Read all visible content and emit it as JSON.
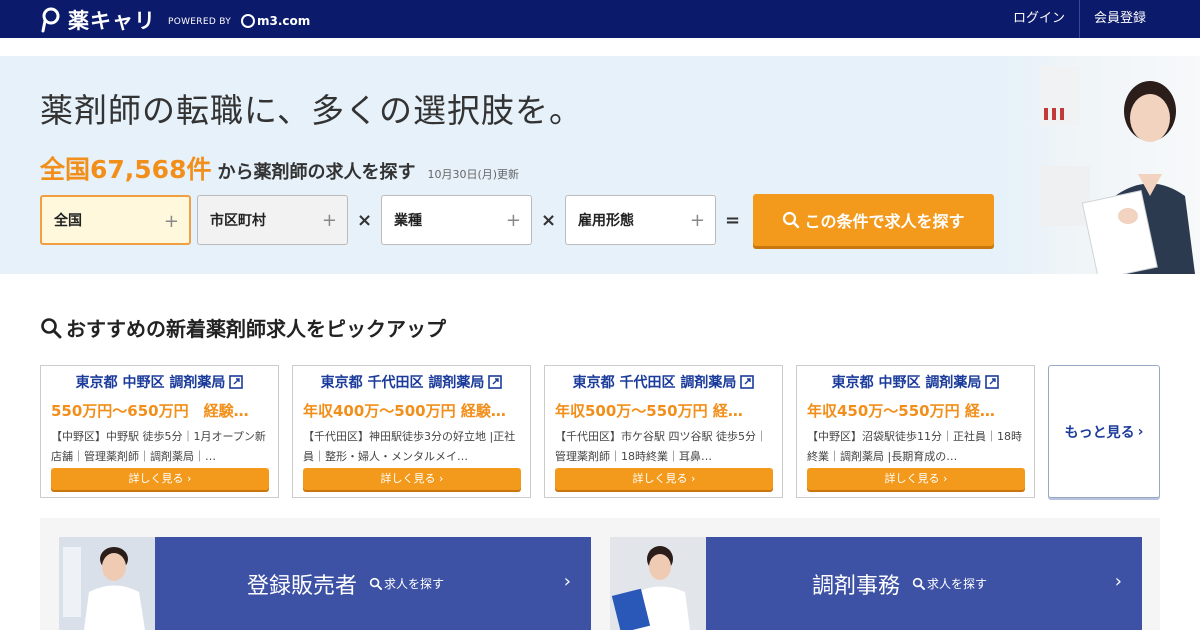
{
  "header": {
    "logo_text": "薬キャリ",
    "powered_by": "POWERED BY",
    "partner": "m3.com",
    "nav": [
      "ログイン",
      "会員登録"
    ]
  },
  "hero": {
    "title": "薬剤師の転職に、多くの選択肢を。",
    "count": "全国67,568件",
    "sub": "から薬剤師の求人を探す",
    "updated": "10月30日(月)更新",
    "filters": [
      "全国",
      "市区町村",
      "業種",
      "雇用形態"
    ],
    "op_times": "×",
    "op_equals": "=",
    "search_button": "この条件で求人を探す"
  },
  "section": {
    "title": "おすすめの新着薬剤師求人をピックアップ"
  },
  "cards": [
    {
      "title": "東京都 中野区 調剤薬局",
      "salary": "550万円〜650万円　経験…",
      "desc": "【中野区】中野駅 徒歩5分｜1月オープン新店舗｜管理薬剤師｜調剤薬局｜…",
      "button": "詳しく見る"
    },
    {
      "title": "東京都 千代田区 調剤薬局",
      "salary": "年収400万〜500万円 経験…",
      "desc": "【千代田区】神田駅徒歩3分の好立地 |正社員｜整形・婦人・メンタルメイ…",
      "button": "詳しく見る"
    },
    {
      "title": "東京都 千代田区 調剤薬局",
      "salary": "年収500万〜550万円 経…",
      "desc": "【千代田区】市ケ谷駅 四ツ谷駅 徒歩5分｜管理薬剤師｜18時終業｜耳鼻…",
      "button": "詳しく見る"
    },
    {
      "title": "東京都 中野区 調剤薬局",
      "salary": "年収450万〜550万円 経…",
      "desc": "【中野区】沼袋駅徒歩11分｜正社員｜18時終業｜調剤薬局 |長期育成の…",
      "button": "詳しく見る"
    }
  ],
  "more": "もっと見る",
  "panels": [
    {
      "label": "登録販売者",
      "search": "求人を探す"
    },
    {
      "label": "調剤事務",
      "search": "求人を探す"
    }
  ],
  "colors": {
    "header_bg": "#0b1a6b",
    "accent_orange": "#f39a1d",
    "link_blue": "#1c3c9c",
    "panel_bg": "#3d52a4",
    "hero_bg": "#e6f1fa"
  }
}
